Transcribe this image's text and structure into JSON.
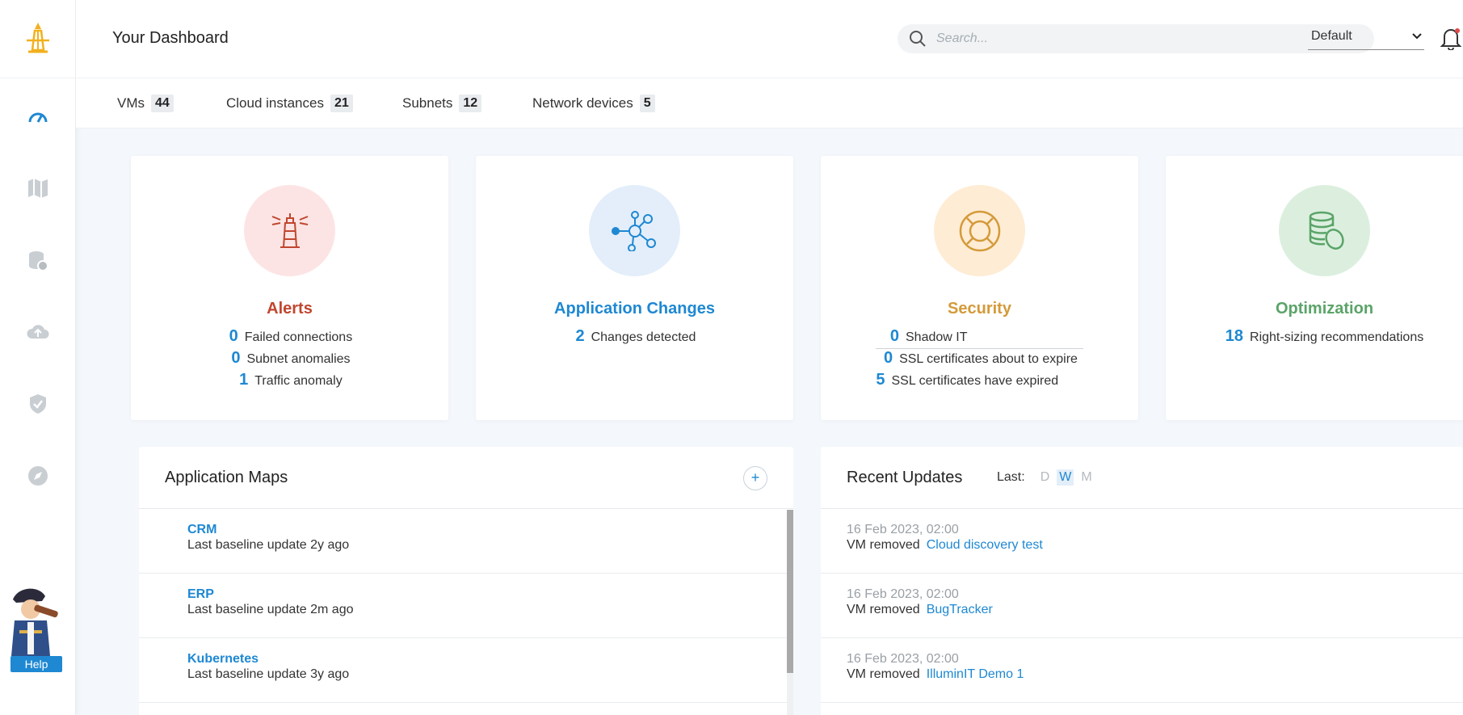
{
  "header": {
    "title": "Your Dashboard",
    "search_placeholder": "Search...",
    "view_select": "Default"
  },
  "counts": [
    {
      "label": "VMs",
      "value": "44"
    },
    {
      "label": "Cloud instances",
      "value": "21"
    },
    {
      "label": "Subnets",
      "value": "12"
    },
    {
      "label": "Network devices",
      "value": "5"
    }
  ],
  "sidebar": {
    "items": [
      "dashboard-icon",
      "map-icon",
      "database-icon",
      "cloud-upload-icon",
      "shield-icon",
      "compass-icon"
    ],
    "help_label": "Help"
  },
  "cards": [
    {
      "title": "Alerts",
      "color": "#c0462e",
      "rows": [
        {
          "num": "0",
          "text": "Failed connections"
        },
        {
          "num": "0",
          "text": "Subnet anomalies"
        },
        {
          "num": "1",
          "text": "Traffic anomaly"
        }
      ]
    },
    {
      "title": "Application Changes",
      "color": "#1e88d2",
      "rows": [
        {
          "num": "2",
          "text": "Changes detected"
        }
      ]
    },
    {
      "title": "Security",
      "color": "#d49a3a",
      "rows": [
        {
          "num": "0",
          "text": "Shadow IT"
        },
        {
          "num": "0",
          "text": "SSL certificates about to expire"
        },
        {
          "num": "5",
          "text": "SSL certificates have expired"
        }
      ]
    },
    {
      "title": "Optimization",
      "color": "#5aa468",
      "rows": [
        {
          "num": "18",
          "text": "Right-sizing recommendations"
        }
      ]
    }
  ],
  "app_maps": {
    "title": "Application Maps",
    "add_label": "+",
    "items": [
      {
        "name": "CRM",
        "sub": "Last baseline update 2y ago"
      },
      {
        "name": "ERP",
        "sub": "Last baseline update 2m ago"
      },
      {
        "name": "Kubernetes",
        "sub": "Last baseline update 3y ago"
      }
    ]
  },
  "recent": {
    "title": "Recent Updates",
    "last_label": "Last:",
    "options": [
      "D",
      "W",
      "M"
    ],
    "active_option": "W",
    "items": [
      {
        "time": "16 Feb 2023, 02:00",
        "action": "VM removed",
        "target": "Cloud discovery test"
      },
      {
        "time": "16 Feb 2023, 02:00",
        "action": "VM removed",
        "target": "BugTracker"
      },
      {
        "time": "16 Feb 2023, 02:00",
        "action": "VM removed",
        "target": "IlluminIT Demo 1"
      }
    ]
  }
}
